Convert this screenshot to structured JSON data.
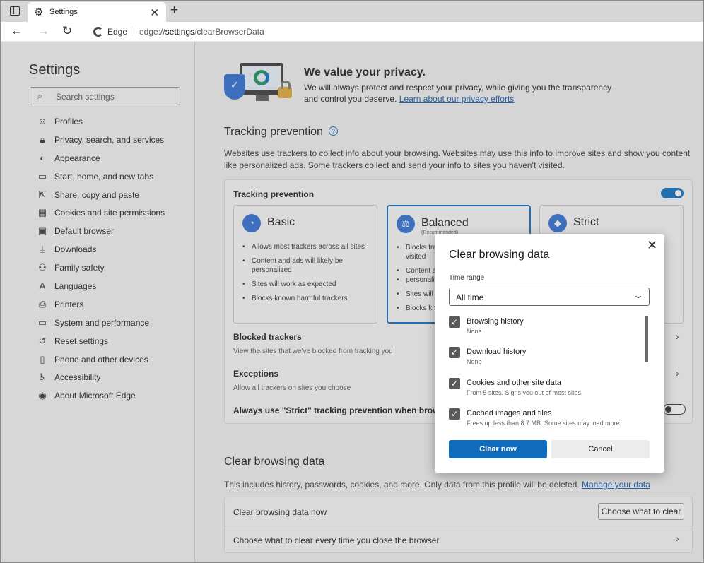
{
  "browser": {
    "tab_title": "Settings",
    "tab_close": "✕",
    "new_tab": "+",
    "brand": "Edge",
    "url_prefix": "edge://",
    "url_path": "settings",
    "url_suffix": "/clearBrowserData"
  },
  "sidebar": {
    "title": "Settings",
    "search_placeholder": "Search settings",
    "items": [
      {
        "label": "Profiles",
        "icon": "profile-icon"
      },
      {
        "label": "Privacy, search, and services",
        "icon": "lock-icon"
      },
      {
        "label": "Appearance",
        "icon": "palette-icon"
      },
      {
        "label": "Start, home, and new tabs",
        "icon": "home-icon"
      },
      {
        "label": "Share, copy and paste",
        "icon": "share-icon"
      },
      {
        "label": "Cookies and site permissions",
        "icon": "cookies-icon"
      },
      {
        "label": "Default browser",
        "icon": "browser-icon"
      },
      {
        "label": "Downloads",
        "icon": "download-icon"
      },
      {
        "label": "Family safety",
        "icon": "family-icon"
      },
      {
        "label": "Languages",
        "icon": "language-icon"
      },
      {
        "label": "Printers",
        "icon": "printer-icon"
      },
      {
        "label": "System and performance",
        "icon": "laptop-icon"
      },
      {
        "label": "Reset settings",
        "icon": "reset-icon"
      },
      {
        "label": "Phone and other devices",
        "icon": "phone-icon"
      },
      {
        "label": "Accessibility",
        "icon": "accessibility-icon"
      },
      {
        "label": "About Microsoft Edge",
        "icon": "edge-logo-icon"
      }
    ]
  },
  "hero": {
    "title": "We value your privacy.",
    "line1": "We will always protect and respect your privacy, while giving you the transparency",
    "line2_text": "and control you deserve.",
    "link": "Learn about our privacy efforts"
  },
  "tracking": {
    "section_title": "Tracking prevention",
    "description": "Websites use trackers to collect info about your browsing. Websites may use this info to improve sites and show you content like personalized ads. Some trackers collect and send your info to sites you haven't visited.",
    "card_label": "Tracking prevention",
    "enabled": true,
    "levels": [
      {
        "name": "Basic",
        "recommended": "",
        "bullets": [
          "Allows most trackers across all sites",
          "Content and ads will likely be personalized",
          "Sites will work as expected",
          "Blocks known harmful trackers"
        ]
      },
      {
        "name": "Balanced",
        "recommended": "(Recommended)",
        "bullets": [
          "Blocks trac",
          "visited",
          "Content an",
          "personaliz",
          "Sites will w",
          "Blocks kno"
        ]
      },
      {
        "name": "Strict",
        "recommended": "",
        "bullets": []
      }
    ],
    "blocked_title": "Blocked trackers",
    "blocked_desc": "View the sites that we've blocked from tracking you",
    "exceptions_title": "Exceptions",
    "exceptions_desc": "Allow all trackers on sites you choose",
    "strict_inprivate": "Always use \"Strict\" tracking prevention when browsing I"
  },
  "clear_section": {
    "title": "Clear browsing data",
    "desc_text": "This includes history, passwords, cookies, and more. Only data from this profile will be deleted.",
    "desc_link": "Manage your data",
    "now_label": "Clear browsing data now",
    "choose_button": "Choose what to clear",
    "on_close_label": "Choose what to clear every time you close the browser"
  },
  "dialog": {
    "title": "Clear browsing data",
    "time_range_label": "Time range",
    "time_range_value": "All time",
    "items": [
      {
        "title": "Browsing history",
        "detail": "None",
        "checked": true
      },
      {
        "title": "Download history",
        "detail": "None",
        "checked": true
      },
      {
        "title": "Cookies and other site data",
        "detail": "From 5 sites. Signs you out of most sites.",
        "checked": true
      },
      {
        "title": "Cached images and files",
        "detail": "Frees up less than 8.7 MB. Some sites may load more",
        "checked": true
      }
    ],
    "clear_button": "Clear now",
    "cancel_button": "Cancel"
  },
  "colors": {
    "accent": "#0f6cbd",
    "link": "#0f5ab4"
  }
}
